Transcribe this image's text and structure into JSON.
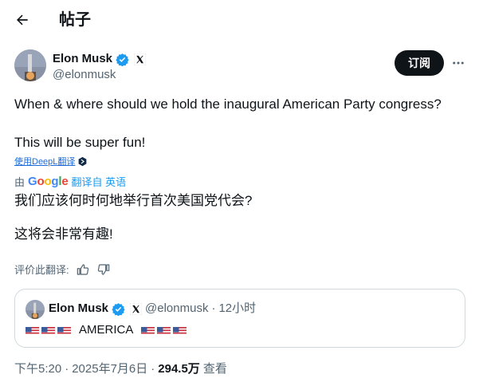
{
  "header": {
    "title": "帖子",
    "back_icon": "arrow-left-icon"
  },
  "author": {
    "name": "Elon Musk",
    "handle": "@elonmusk",
    "verified_color": "#1d9bf0",
    "follow_label": "订阅"
  },
  "tweet": {
    "line1": "When & where should we hold the inaugural American Party congress?",
    "line2": "This will be super fun!",
    "deepl_label": "使用DeepL翻译",
    "by_label": "由",
    "google_label": "Google",
    "translate_label": "翻译自 英语",
    "translated_line1": "我们应该何时何地举行首次美国党代会?",
    "translated_line2": "这将会非常有趣!"
  },
  "rating": {
    "label": "评价此翻译:"
  },
  "quote": {
    "name": "Elon Musk",
    "handle": "@elonmusk",
    "separator": "·",
    "time": "12小时",
    "text": "AMERICA"
  },
  "meta": {
    "time": "下午5:20",
    "dot1": "·",
    "date": "2025年7月6日",
    "dot2": "·",
    "views": "294.5万",
    "views_label": "查看"
  },
  "colors": {
    "accent": "#1d9bf0",
    "text": "#0f1419",
    "muted": "#536471",
    "border": "#cfd9de"
  }
}
